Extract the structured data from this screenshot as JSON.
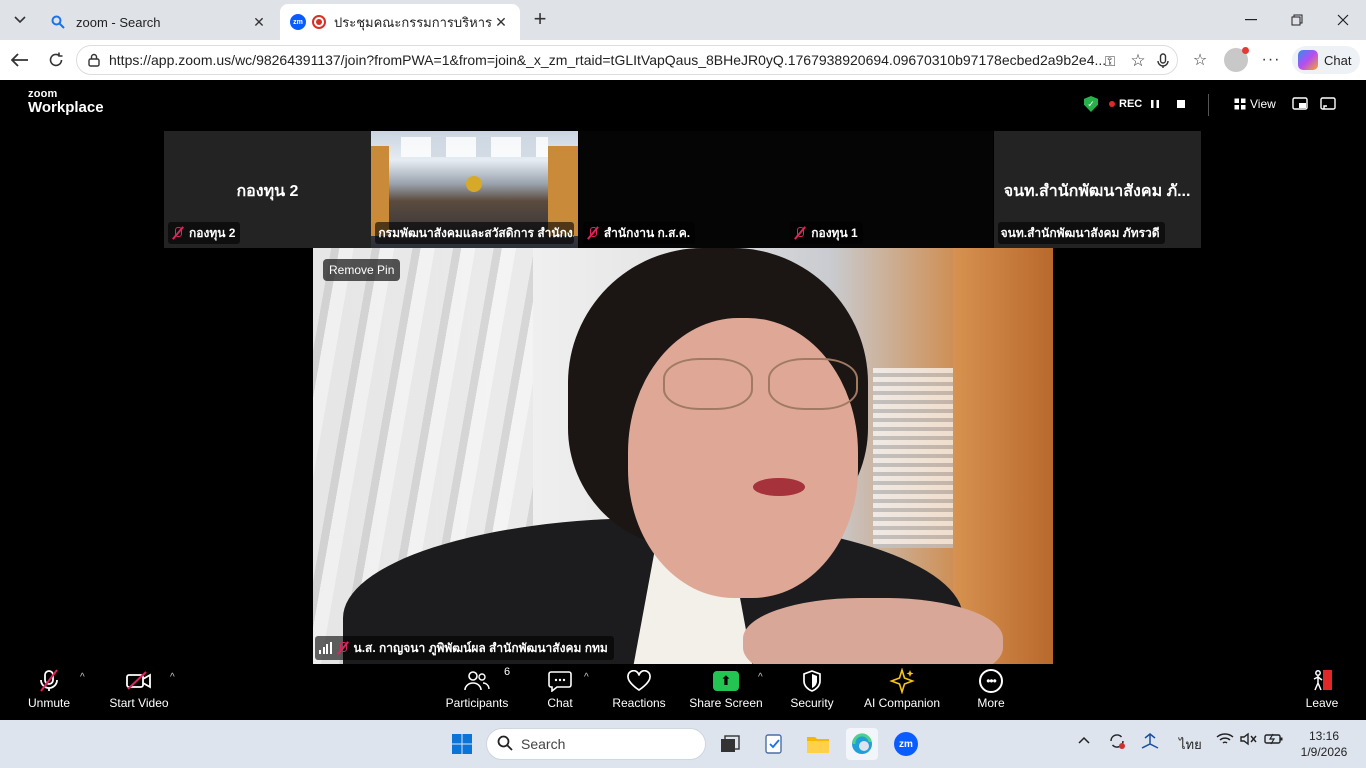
{
  "browser": {
    "tabs": [
      {
        "title": "zoom - Search"
      },
      {
        "title": "ประชุมคณะกรรมการบริหารกองทุนส่งเสริมการจัดสวัสดิการสังคม"
      }
    ],
    "url": "https://app.zoom.us/wc/98264391137/join?fromPWA=1&from=join&_x_zm_rtaid=tGLItVapQaus_8BHeJR0yQ.1767938920694.09670310b97178ecbed2a9b2e4...",
    "copilot_label": "Chat"
  },
  "zoom": {
    "brand_small": "zoom",
    "brand_big": "Workplace",
    "rec_label": "REC",
    "view_label": "View",
    "remove_pin_label": "Remove Pin",
    "thumbnails": [
      {
        "big_name": "กองทุน 2",
        "label": "กองทุน 2",
        "muted": true
      },
      {
        "big_name": "",
        "label": "กรมพัฒนาสังคมและสวัสดิการ สำนักง...",
        "muted": false
      },
      {
        "big_name": "",
        "label": "สำนักงาน ก.ส.ค.",
        "muted": true
      },
      {
        "big_name": "",
        "label": "กองทุน 1",
        "muted": true
      },
      {
        "big_name": "จนท.สำนักพัฒนาสังคม ภั...",
        "label": "จนท.สำนักพัฒนาสังคม ภัทรวดี",
        "muted": false
      }
    ],
    "main_speaker_label": "น.ส. กาญจนา ภูพิพัฒน์ผล สำนักพัฒนาสังคม กทม",
    "controls": {
      "unmute": "Unmute",
      "start_video": "Start Video",
      "participants": "Participants",
      "participants_count": "6",
      "chat": "Chat",
      "reactions": "Reactions",
      "share_screen": "Share Screen",
      "security": "Security",
      "ai_companion": "AI Companion",
      "more": "More",
      "leave": "Leave"
    }
  },
  "taskbar": {
    "search_placeholder": "Search",
    "language": "ไทย",
    "time": "13:16",
    "date": "1/9/2026"
  }
}
